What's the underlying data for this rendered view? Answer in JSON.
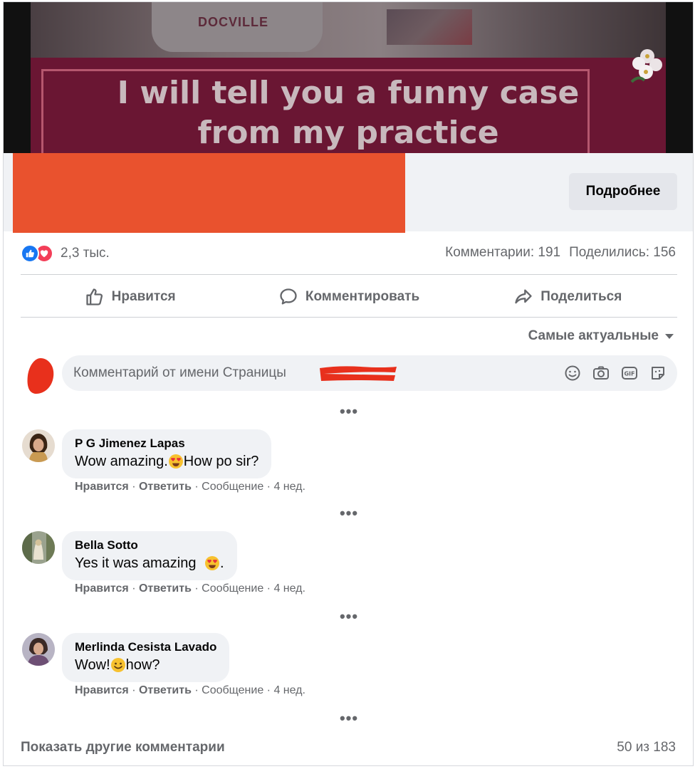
{
  "banner": {
    "headline_line1": "I will tell you a funny case",
    "headline_line2": "from my practice",
    "shirt_text": "DOCVILLE"
  },
  "info": {
    "more_button": "Подробнее"
  },
  "reactions": {
    "count": "2,3 тыс.",
    "like_color": "#1877f2",
    "love_color": "#f33e58",
    "comments_stat": "Комментарии: 191",
    "shares_stat": "Поделились: 156"
  },
  "actions": {
    "like": "Нравится",
    "comment": "Комментировать",
    "share": "Поделиться"
  },
  "sort": {
    "label": "Самые актуальные"
  },
  "composer": {
    "placeholder": "Комментарий от имени Страницы"
  },
  "comments": [
    {
      "author": "P G Jimenez Lapas",
      "text_before": "Wow amazing.",
      "emoji": "heart-eyes",
      "text_after": "How po sir?",
      "like": "Нравится",
      "reply": "Ответить",
      "message": "Сообщение",
      "time": "4 нед."
    },
    {
      "author": "Bella Sotto",
      "text_before": "Yes it was amazing ",
      "emoji": "heart-eyes",
      "text_after": ".",
      "like": "Нравится",
      "reply": "Ответить",
      "message": "Сообщение",
      "time": "4 нед."
    },
    {
      "author": "Merlinda Cesista Lavado",
      "text_before": "Wow!",
      "emoji": "smile",
      "text_after": "how?",
      "like": "Нравится",
      "reply": "Ответить",
      "message": "Сообщение",
      "time": "4 нед."
    }
  ],
  "footer": {
    "show_more": "Показать другие комментарии",
    "count": "50 из 183"
  },
  "colors": {
    "redaction": "#e9522e",
    "panel": "#f0f2f5",
    "muted_text": "#65676b"
  }
}
